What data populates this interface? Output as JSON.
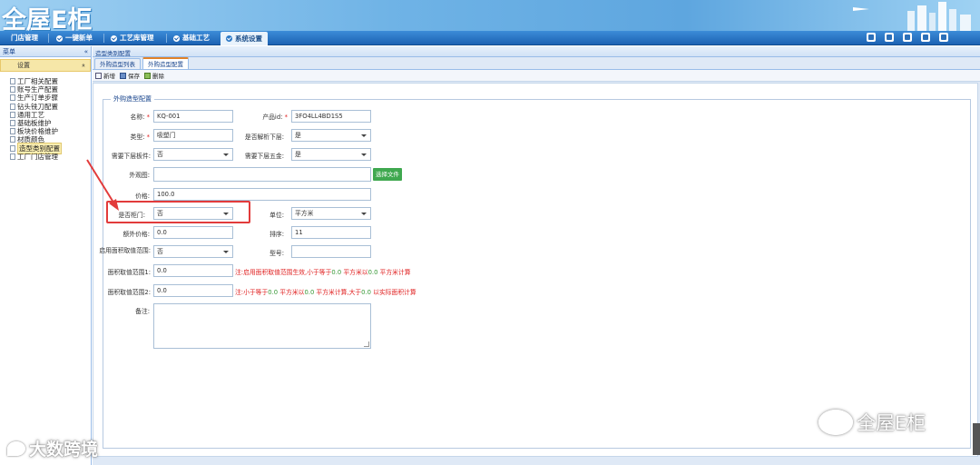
{
  "app": {
    "logo_text": "全屋E柜"
  },
  "nav": {
    "items": [
      {
        "label": "门店管理"
      },
      {
        "label": "一键新单"
      },
      {
        "label": "工艺库管理"
      },
      {
        "label": "基础工艺"
      },
      {
        "label": "系统设置"
      }
    ]
  },
  "sidebar": {
    "header": "菜单",
    "collapse": "«",
    "section": "设置",
    "section_toggle": "»",
    "items": [
      {
        "label": "工厂相关配置"
      },
      {
        "label": "账号生产配置"
      },
      {
        "label": "生产订单步骤"
      },
      {
        "label": "钻头铣刀配置"
      },
      {
        "label": "通用工艺"
      },
      {
        "label": "基础板维护"
      },
      {
        "label": "板块价格维护"
      },
      {
        "label": "材质颜色"
      },
      {
        "label": "造型类别配置"
      },
      {
        "label": "工厂门店管理"
      }
    ]
  },
  "main": {
    "breadcrumb": "造型类别配置",
    "tabs": [
      {
        "label": "外购造型列表"
      },
      {
        "label": "外购造型配置"
      }
    ],
    "toolbar": {
      "add": "新增",
      "save": "保存",
      "delete": "删除"
    }
  },
  "form": {
    "legend": "外购造型配置",
    "name_label": "名称:",
    "name_value": "KQ-001",
    "product_id_label": "产品id:",
    "product_id_value": "3FO4LL4BD1S5",
    "type_label": "类型:",
    "type_value": "吸塑门",
    "parse_lower_label": "是否解析下层:",
    "parse_lower_value": "是",
    "need_lower_board_label": "需要下层板件:",
    "need_lower_board_value": "否",
    "need_lower_hardware_label": "需要下层五金:",
    "need_lower_hardware_value": "是",
    "appearance_label": "外观图:",
    "appearance_value": "",
    "upload_button": "选择文件",
    "price_label": "价格:",
    "price_value": "100.0",
    "is_door_label": "是否柜门:",
    "is_door_value": "否",
    "unit_label": "单位:",
    "unit_value": "平方米",
    "extra_price_label": "额外价格:",
    "extra_price_value": "0.0",
    "sort_label": "排序:",
    "sort_value": "11",
    "enable_area_label": "启用面积取值范围:",
    "enable_area_value": "否",
    "model_label": "型号:",
    "model_value": "",
    "area_range1_label": "面积取值范围1:",
    "area_range1_value": "0.0",
    "area_range1_note": {
      "a": "注:启用面积取值范围生效,小于等于",
      "n1": "0.0",
      "b": " 平方米以",
      "n2": "0.0",
      "c": " 平方米计算"
    },
    "area_range2_label": "面积取值范围2:",
    "area_range2_value": "0.0",
    "area_range2_note": {
      "a": "注:小于等于",
      "n1": "0.0",
      "b": " 平方米以",
      "n2": "0.0",
      "c": " 平方米计算,大于",
      "n3": "0.0",
      "d": " 以实际面积计算"
    },
    "remark_label": "备注:",
    "remark_value": ""
  },
  "watermarks": {
    "left": "大数跨境",
    "right": "全屋E柜"
  },
  "colors": {
    "nav_bar": "#1d63b3",
    "highlight_box": "#e23b3b",
    "upload_button": "#3fa84f",
    "note_text": "#e02020"
  }
}
